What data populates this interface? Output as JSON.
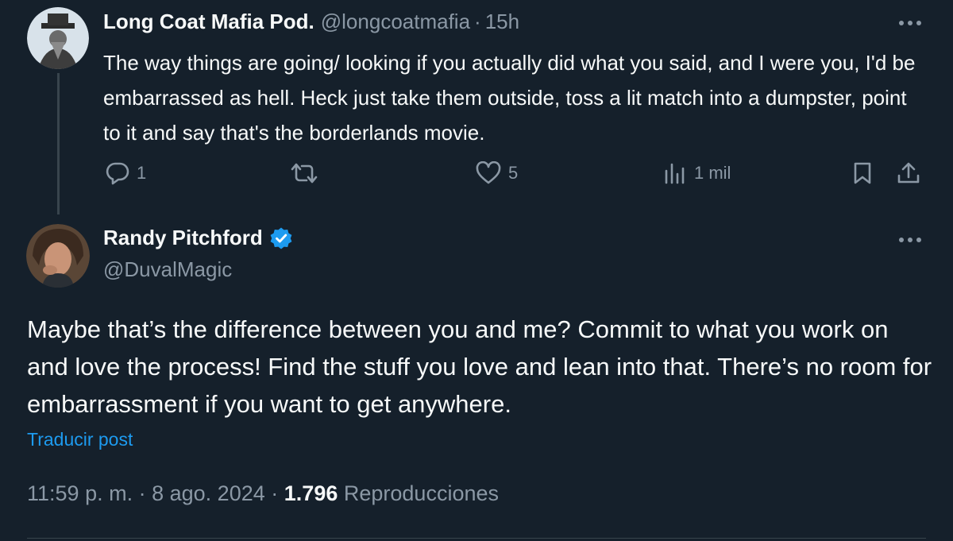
{
  "parent_tweet": {
    "display_name": "Long Coat Mafia Pod.",
    "handle": "@longcoatmafia",
    "separator": "·",
    "time": "15h",
    "text": "The way things are going/ looking if you actually did what you said, and I were you, I'd be embarrassed as hell. Heck just take them outside, toss a lit match into a dumpster, point to it and say that's the borderlands movie.",
    "actions": {
      "reply_count": "1",
      "retweet_count": "",
      "like_count": "5",
      "views_count": "1 mil"
    },
    "icons": [
      "more-icon",
      "reply-icon",
      "retweet-icon",
      "like-icon",
      "views-icon",
      "bookmark-icon",
      "share-icon"
    ]
  },
  "main_tweet": {
    "display_name": "Randy Pitchford",
    "verified": true,
    "handle": "@DuvalMagic",
    "text": "Maybe that’s the difference between you and me? Commit to what you work on and love the process! Find the stuff you love and lean into that. There’s no room for embarrassment if you want to get anywhere.",
    "translate_label": "Traducir post",
    "meta": {
      "time": "11:59 p. m.",
      "separator": "·",
      "date": "8 ago. 2024",
      "views_count": "1.796",
      "views_label": "Reproducciones"
    }
  },
  "colors": {
    "background": "#15202b",
    "text": "#f7f9f9",
    "muted": "#8b98a5",
    "accent": "#1d9bf0",
    "thread_line": "#38444d"
  }
}
